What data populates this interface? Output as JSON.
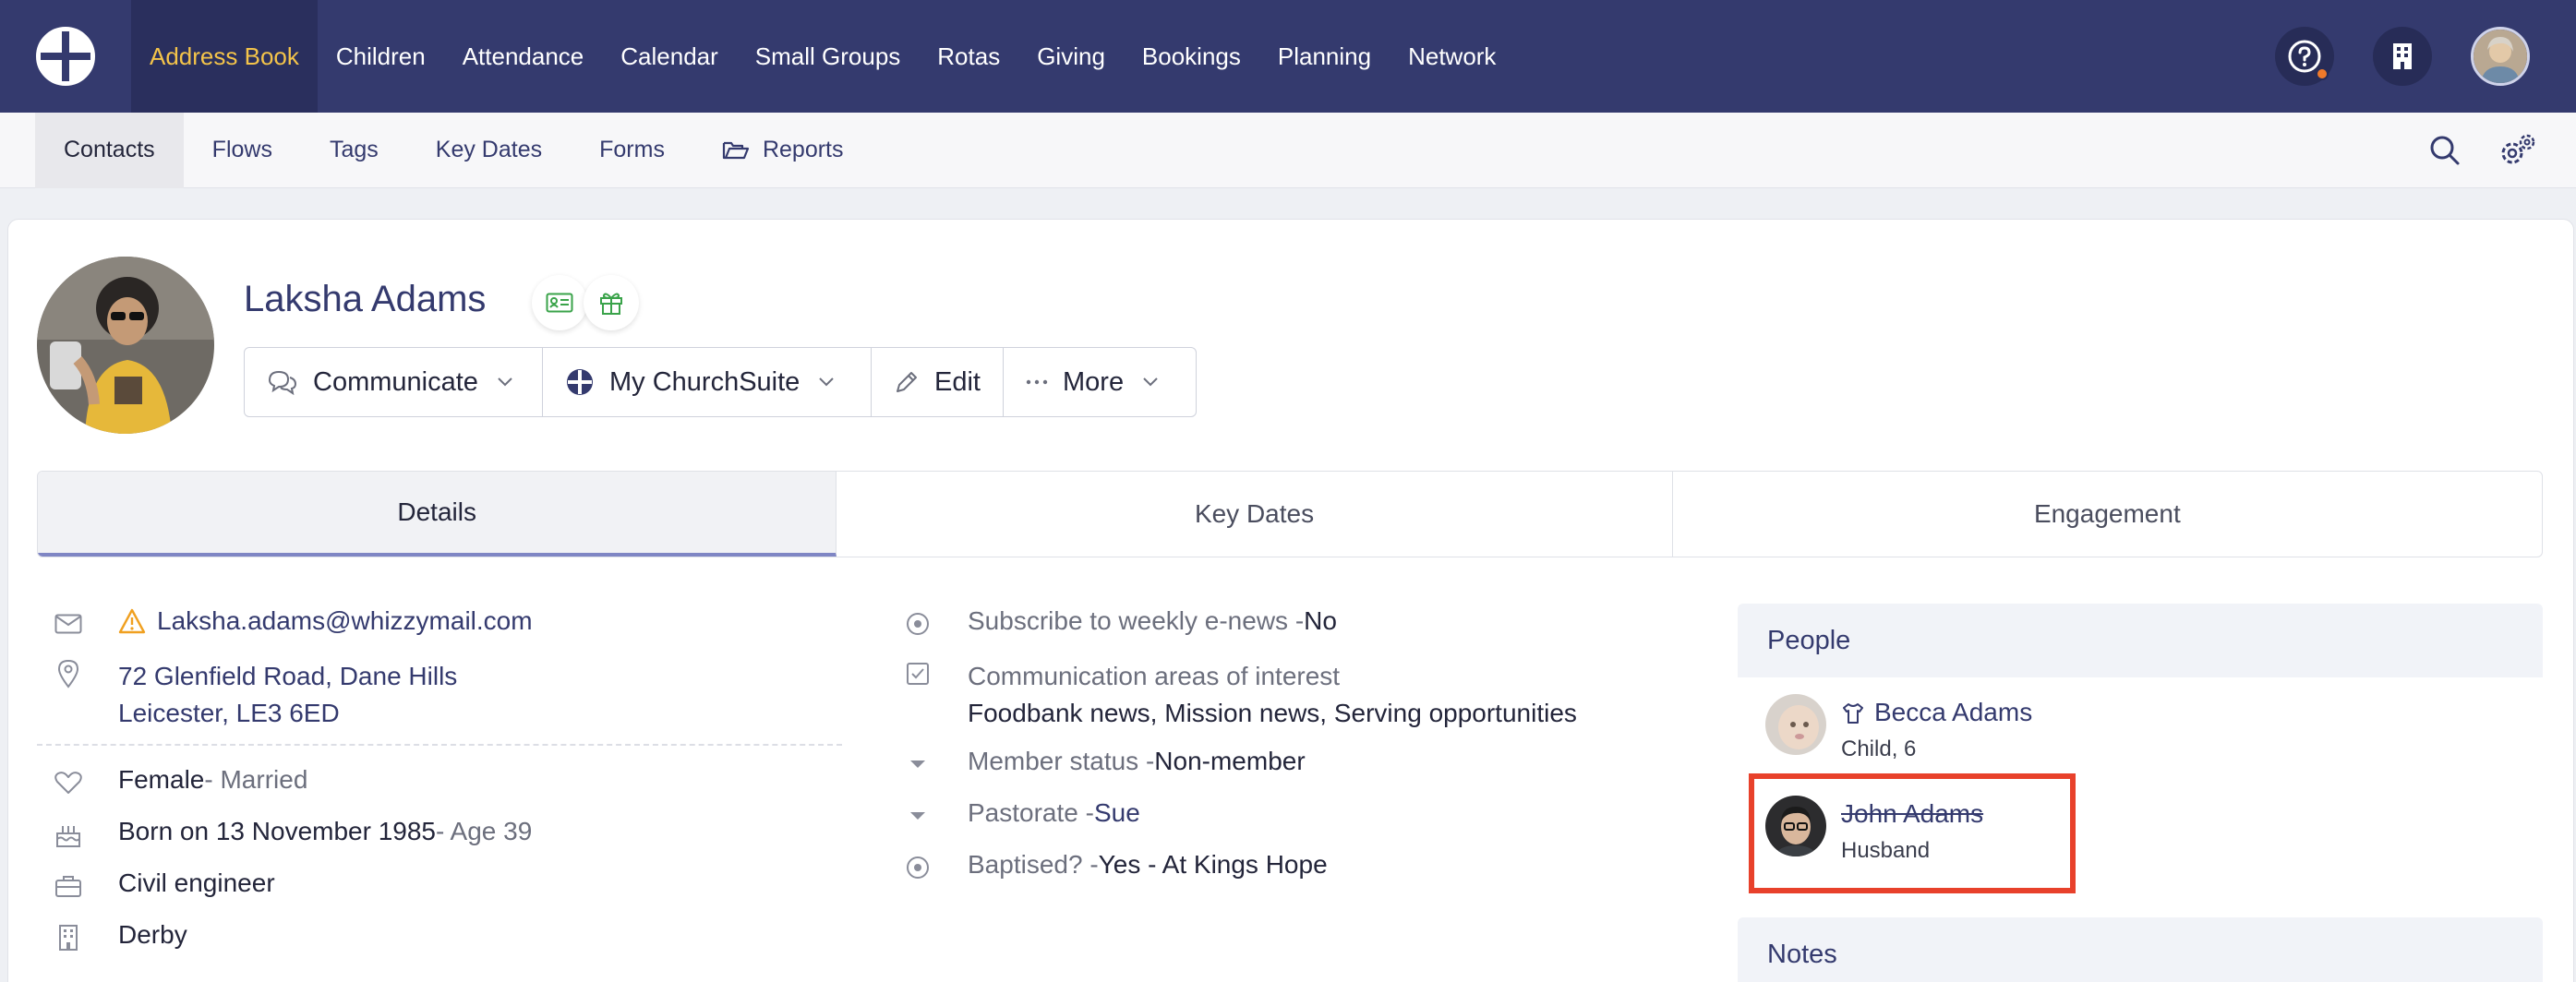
{
  "topnav": {
    "items": [
      "Address Book",
      "Children",
      "Attendance",
      "Calendar",
      "Small Groups",
      "Rotas",
      "Giving",
      "Bookings",
      "Planning",
      "Network"
    ],
    "active": "Address Book"
  },
  "subnav": {
    "items": [
      "Contacts",
      "Flows",
      "Tags",
      "Key Dates",
      "Forms",
      "Reports"
    ],
    "active": "Contacts"
  },
  "profile": {
    "name": "Laksha Adams"
  },
  "actions": {
    "communicate": "Communicate",
    "my_churchsuite": "My ChurchSuite",
    "edit": "Edit",
    "more": "More"
  },
  "tabs": [
    "Details",
    "Key Dates",
    "Engagement"
  ],
  "details": {
    "email": "Laksha.adams@whizzymail.com",
    "address_line1": "72 Glenfield Road, Dane Hills",
    "address_line2": "Leicester, LE3 6ED",
    "sex": "Female",
    "marital": " - Married",
    "born": "Born on 13 November 1985",
    "age": " - Age 39",
    "job": "Civil engineer",
    "site": "Derby"
  },
  "custom_fields": {
    "enews_label": "Subscribe to weekly e-news - ",
    "enews_value": "No",
    "interests_label": "Communication areas of interest",
    "interests_value": "Foodbank news, Mission news, Serving opportunities",
    "member_label": "Member status - ",
    "member_value": "Non-member",
    "pastorate_label": "Pastorate - ",
    "pastorate_value": "Sue",
    "baptised_label": "Baptised? - ",
    "baptised_value": "Yes - At Kings Hope"
  },
  "people": {
    "heading": "People",
    "members": [
      {
        "name": "Becca Adams",
        "relation": "Child, 6"
      },
      {
        "name": "John Adams",
        "relation": "Husband"
      }
    ]
  },
  "notes": {
    "heading": "Notes"
  },
  "colors": {
    "nav_bg": "#343a6e",
    "nav_active_text": "#f4c44a",
    "link": "#343a6e",
    "highlight": "#e8412b",
    "warning": "#f0a020"
  }
}
